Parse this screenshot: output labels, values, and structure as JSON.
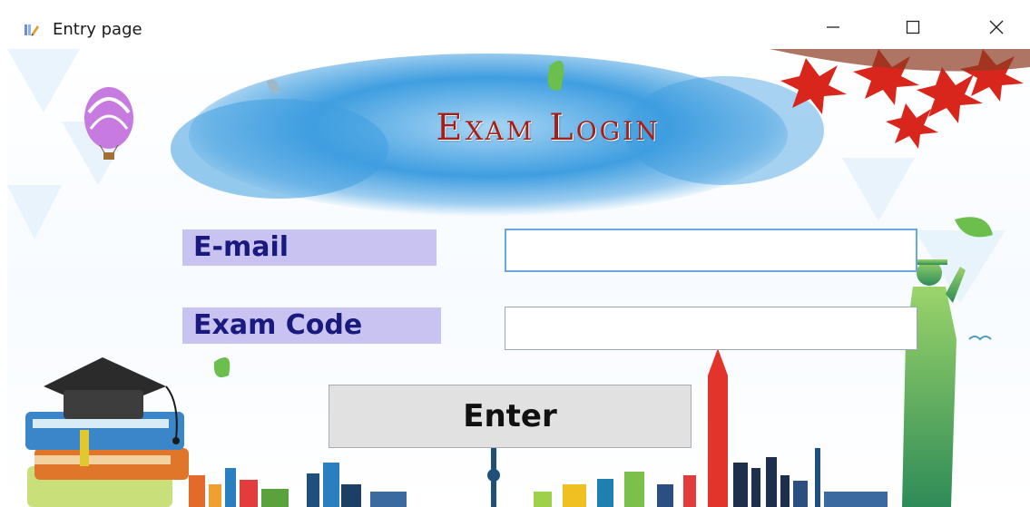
{
  "window": {
    "title": "Entry page",
    "app_icon": "form-app-icon",
    "controls": [
      "minimize-icon",
      "maximize-icon",
      "close-icon"
    ]
  },
  "login": {
    "heading": "Exam Login",
    "email_label": "E-mail",
    "email_value": "",
    "code_label": "Exam Code",
    "code_value": "",
    "enter_label": "Enter"
  },
  "colors": {
    "heading": "#a3201a",
    "label_bg": "#c9c3f2",
    "label_text": "#1a1a7e",
    "button_bg": "#e1e1e1"
  }
}
